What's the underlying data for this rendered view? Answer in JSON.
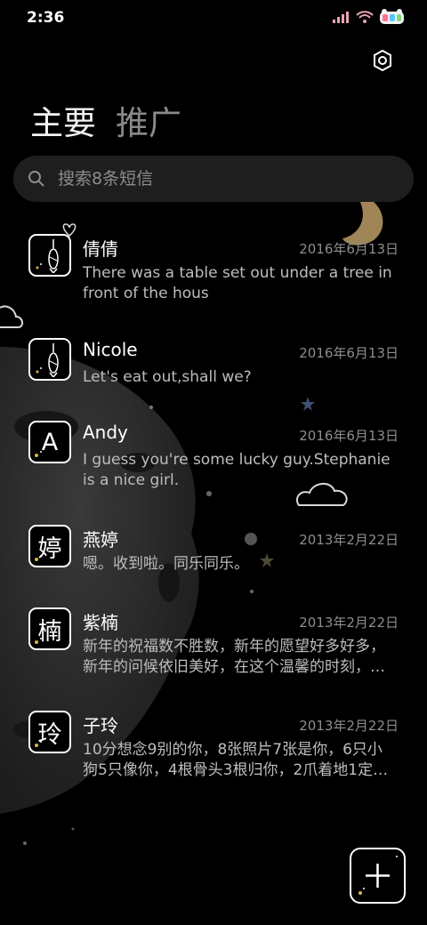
{
  "status_bar": {
    "time": "2:36"
  },
  "tabs": [
    {
      "label": "主要",
      "active": true
    },
    {
      "label": "推广",
      "active": false
    }
  ],
  "search": {
    "placeholder": "搜索8条短信"
  },
  "messages": [
    {
      "avatar_char": "",
      "avatar_icon": "fish-lantern-icon",
      "name": "倩倩",
      "date": "2016年6月13日",
      "preview": "There was a table set out under a tree in front of the hous"
    },
    {
      "avatar_char": "",
      "avatar_icon": "fish-lantern-icon",
      "name": "Nicole",
      "date": "2016年6月13日",
      "preview": "Let's eat out,shall we?"
    },
    {
      "avatar_char": "A",
      "name": "Andy",
      "date": "2016年6月13日",
      "preview": "I guess you're some lucky guy.Stephanie is a nice girl."
    },
    {
      "avatar_char": "婷",
      "name": "燕婷",
      "date": "2013年2月22日",
      "preview": "嗯。收到啦。同乐同乐。"
    },
    {
      "avatar_char": "楠",
      "name": "紫楠",
      "date": "2013年2月22日",
      "preview": "新年的祝福数不胜数，新年的愿望好多好多，新年的问候依旧美好，在这个温馨的时刻，…"
    },
    {
      "avatar_char": "玲",
      "name": "子玲",
      "date": "2013年2月22日",
      "preview": "10分想念9别的你，8张照片7张是你，6只小狗5只像你，4根骨头3根归你，2爪着地1定…"
    }
  ],
  "colors": {
    "background": "#000000",
    "search_bg": "#1e1e1e",
    "moon": "#a08656",
    "secondary_text": "#8d8d8d"
  },
  "icons": {
    "settings": "gear-hexagon-icon",
    "search": "search-icon",
    "compose": "plus-icon"
  }
}
